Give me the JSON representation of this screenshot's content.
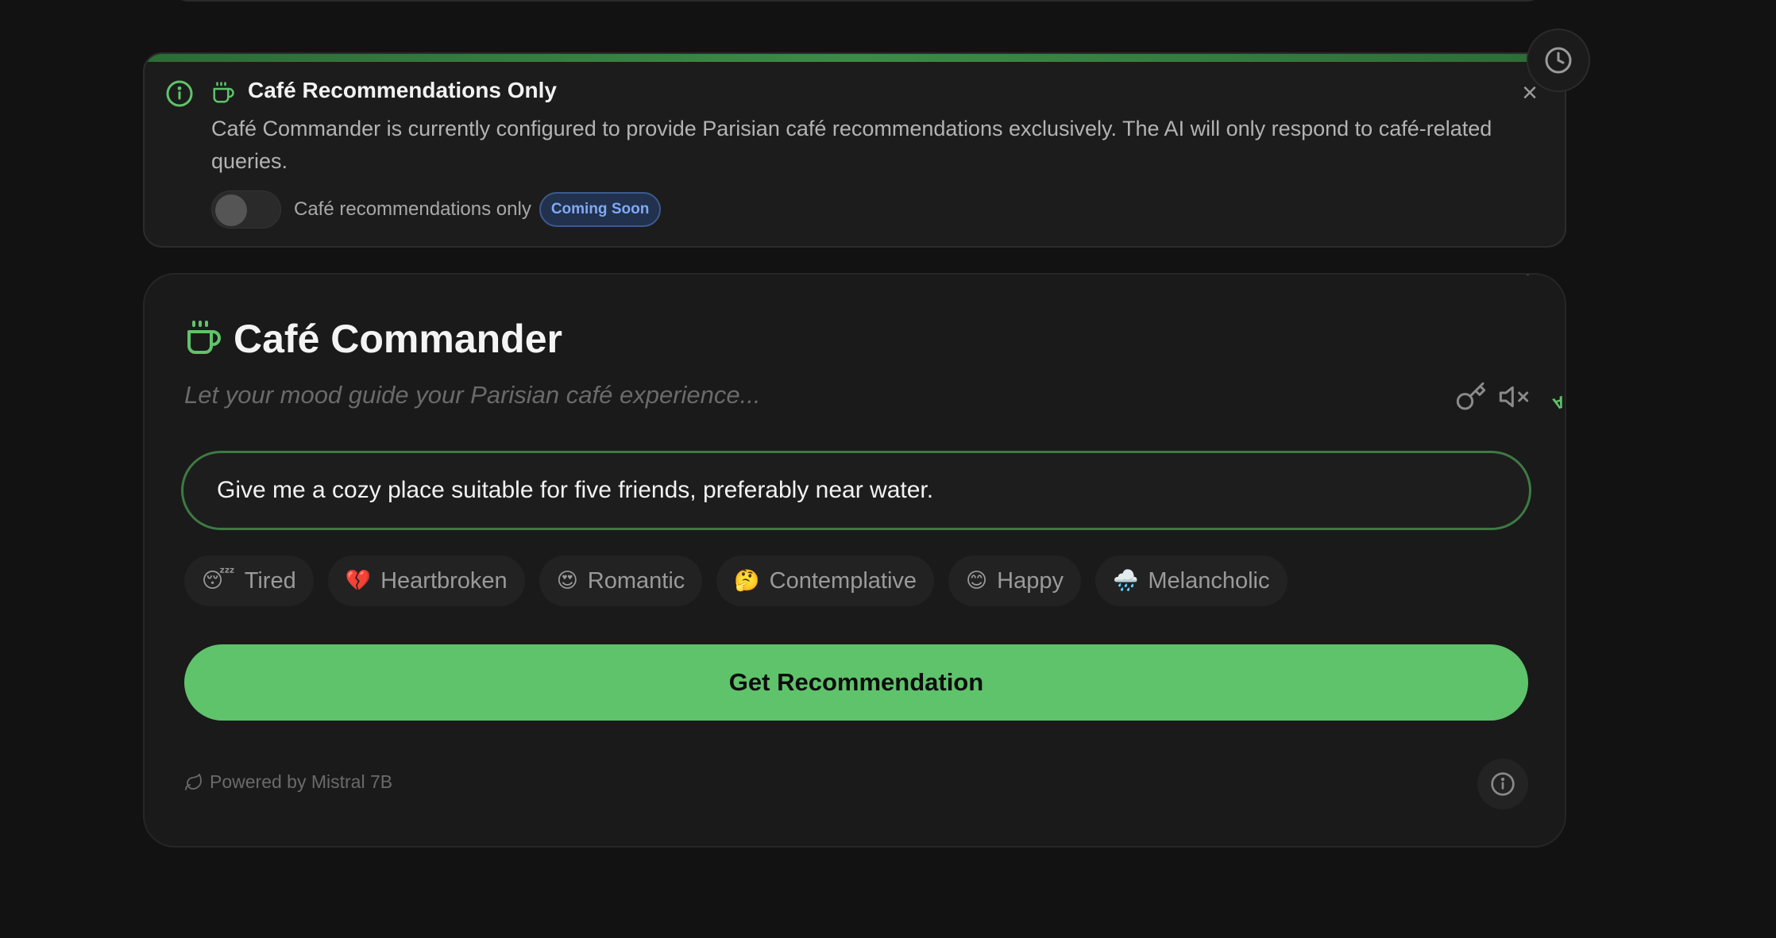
{
  "banner": {
    "title": "Café Recommendations Only",
    "body": "Café Commander is currently configured to provide Parisian café recommendations exclusively. The AI will only respond to café-related queries.",
    "toggle_label": "Café recommendations only",
    "badge": "Coming Soon",
    "close_glyph": "×",
    "toggle_on": false
  },
  "card": {
    "title": "Café Commander",
    "subtitle": "Let your mood guide your Parisian café experience...",
    "rotating_text": "...SS. GET. A",
    "input_value": "Give me a cozy place suitable for five friends, preferably near water.",
    "moods": [
      {
        "emoji": "😴",
        "label": "Tired"
      },
      {
        "emoji": "💔",
        "label": "Heartbroken"
      },
      {
        "emoji": "😍",
        "label": "Romantic"
      },
      {
        "emoji": "🤔",
        "label": "Contemplative"
      },
      {
        "emoji": "😊",
        "label": "Happy"
      },
      {
        "emoji": "🌧️",
        "label": "Melancholic"
      }
    ],
    "button_label": "Get Recommendation",
    "powered_by": "Powered by Mistral 7B"
  },
  "colors": {
    "accent": "#5fc36b",
    "background": "#121212",
    "card": "#1a1a1a",
    "badge_text": "#7fa9f4"
  },
  "icons": [
    "info-icon",
    "coffee-cup-icon",
    "close-icon",
    "history-clock-icon",
    "key-icon",
    "volume-mute-icon",
    "leaf-icon"
  ]
}
